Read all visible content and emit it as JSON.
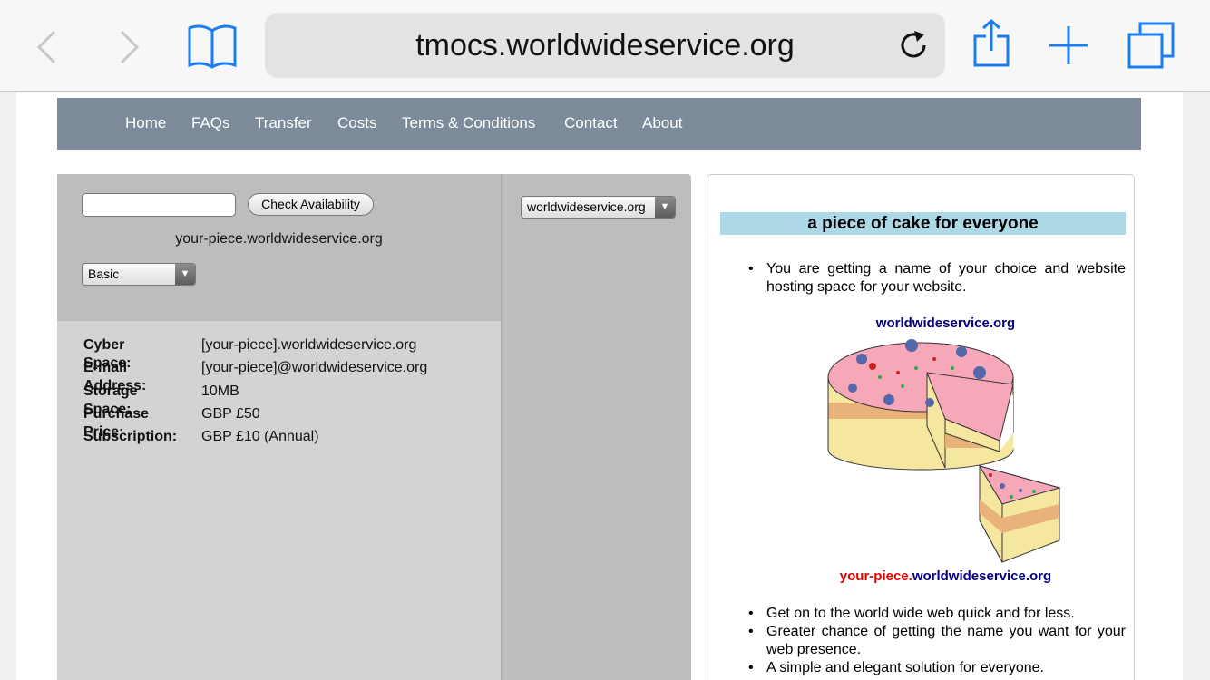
{
  "browser": {
    "url": "tmocs.worldwideservice.org",
    "back_icon": "chevron-left-icon",
    "forward_icon": "chevron-right-icon",
    "bookmarks_icon": "book-icon",
    "reload_icon": "reload-icon",
    "share_icon": "share-icon",
    "new_tab_icon": "plus-icon",
    "tabs_icon": "tabs-icon"
  },
  "nav": {
    "items": [
      "Home",
      "FAQs",
      "Transfer",
      "Costs",
      "Terms & Conditions",
      "Contact",
      "About"
    ]
  },
  "search": {
    "input_value": "",
    "button_label": "Check Availability",
    "preview": "your-piece.worldwideservice.org",
    "plan_selected": "Basic",
    "domain_selected": "worldwideservice.org"
  },
  "details": [
    {
      "label": "Cyber Space:",
      "value": "[your-piece].worldwideservice.org"
    },
    {
      "label": "E-mail Address:",
      "value": "[your-piece]@worldwideservice.org"
    },
    {
      "label": "Storage Space:",
      "value": "10MB"
    },
    {
      "label": "Purchase Price:",
      "value": "GBP £50"
    },
    {
      "label": "Subscription:",
      "value": "GBP £10 (Annual)"
    }
  ],
  "promo": {
    "heading": "a piece of cake for everyone",
    "intro": "You are getting a name of your choice and website hosting space for your website.",
    "domain_top": "worldwideservice.org",
    "domain_bottom_red": "your-piece.",
    "domain_bottom_blue": "worldwideservice.org",
    "bullets": [
      "Get on to the world wide web quick and for less.",
      "Greater chance of getting the name you want for your web presence.",
      "A simple and elegant solution for everyone."
    ],
    "colors": {
      "red": "#e00000",
      "blue": "#000080",
      "banner": "#add8e6",
      "nav": "#7c8a99"
    }
  }
}
